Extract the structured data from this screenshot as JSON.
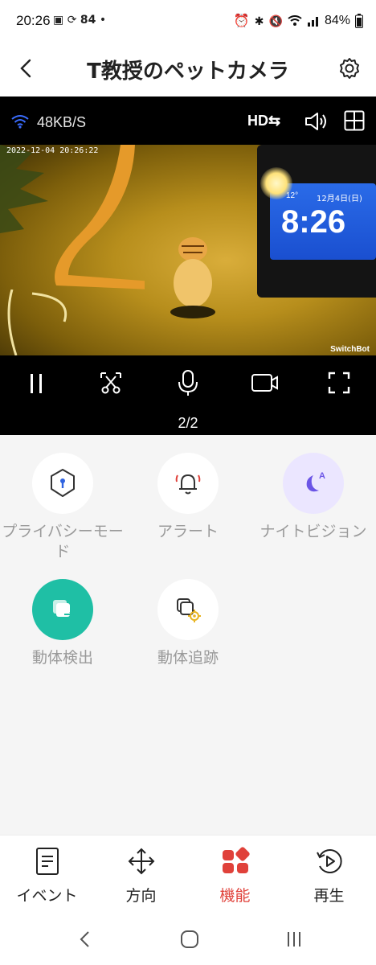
{
  "status_bar": {
    "time": "20:26",
    "notification_count": "84",
    "battery": "84%"
  },
  "header": {
    "title": "T教授のペットカメラ"
  },
  "video": {
    "speed": "48KB/S",
    "quality": "HD⇆",
    "timestamp": "2022-12-04 20:26:22",
    "watermark": "SwitchBot",
    "clock_time": "8:26",
    "clock_temp": "12°",
    "clock_date": "12月4日(日)",
    "pager": "2/2"
  },
  "features": [
    {
      "label": "プライバシーモード",
      "icon": "shield-icon",
      "active": false
    },
    {
      "label": "アラート",
      "icon": "bell-icon",
      "active": false
    },
    {
      "label": "ナイトビジョン",
      "icon": "moon-auto-icon",
      "active": true
    },
    {
      "label": "動体検出",
      "icon": "motion-detect-icon",
      "active": true
    },
    {
      "label": "動体追跡",
      "icon": "motion-track-icon",
      "active": false
    }
  ],
  "bottom_nav": [
    {
      "label": "イベント",
      "icon": "event-list-icon"
    },
    {
      "label": "方向",
      "icon": "direction-icon"
    },
    {
      "label": "機能",
      "icon": "features-icon",
      "selected": true
    },
    {
      "label": "再生",
      "icon": "playback-icon"
    }
  ],
  "colors": {
    "accent_red": "#e0413a",
    "teal": "#1fbfa5",
    "lavender": "#ebe6ff",
    "purple": "#6b55e6",
    "text_gray": "#9a9a9a"
  }
}
